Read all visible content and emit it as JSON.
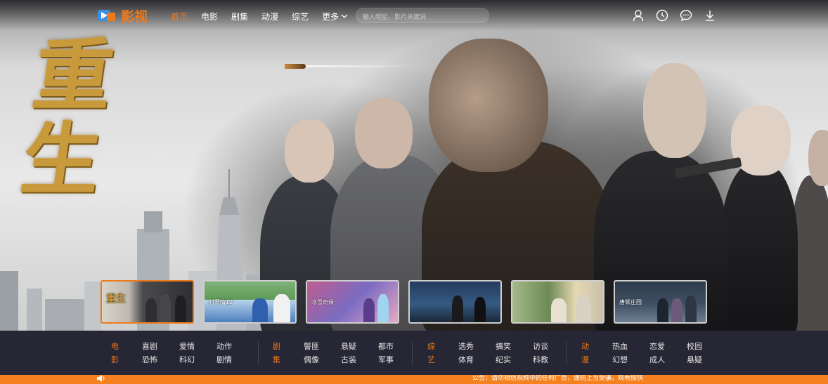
{
  "colors": {
    "accent": "#f07a1a",
    "catbar_bg": "#262634",
    "notice_bg": "#f5821f"
  },
  "logo": {
    "text": "影视",
    "icon": "play-logo-icon"
  },
  "nav": {
    "links": [
      {
        "label": "首页",
        "active": true
      },
      {
        "label": "电影",
        "active": false
      },
      {
        "label": "剧集",
        "active": false
      },
      {
        "label": "动漫",
        "active": false
      },
      {
        "label": "综艺",
        "active": false
      }
    ],
    "more_label": "更多"
  },
  "search": {
    "placeholder": "输入明星、影片关键词",
    "value": ""
  },
  "header_icons": [
    "user-icon",
    "history-clock-icon",
    "message-icon",
    "download-icon"
  ],
  "hero": {
    "title": "重生"
  },
  "thumbnails": [
    {
      "caption": "重生",
      "active": true
    },
    {
      "caption": "村爱情12",
      "active": false
    },
    {
      "caption": "冰雪奇缘",
      "active": false
    },
    {
      "caption": "",
      "active": false
    },
    {
      "caption": "",
      "active": false
    },
    {
      "caption": "唐顿庄园",
      "active": false
    }
  ],
  "categories": [
    {
      "head": [
        "电",
        "影"
      ],
      "columns": [
        [
          "喜剧",
          "恐怖"
        ],
        [
          "爱情",
          "科幻"
        ],
        [
          "动作",
          "剧情"
        ]
      ]
    },
    {
      "head": [
        "剧",
        "集"
      ],
      "columns": [
        [
          "警匪",
          "偶像"
        ],
        [
          "悬疑",
          "古装"
        ],
        [
          "都市",
          "军事"
        ]
      ]
    },
    {
      "head": [
        "综",
        "艺"
      ],
      "columns": [
        [
          "选秀",
          "体育"
        ],
        [
          "搞笑",
          "纪实"
        ],
        [
          "访谈",
          "科教"
        ]
      ]
    },
    {
      "head": [
        "动",
        "漫"
      ],
      "columns": [
        [
          "热血",
          "幻想"
        ],
        [
          "恋爱",
          "成人"
        ],
        [
          "校园",
          "悬疑"
        ]
      ]
    }
  ],
  "notice": {
    "text": "公告：请勿相信视频中的任何广告，谨防上当受骗，观看愉快"
  }
}
